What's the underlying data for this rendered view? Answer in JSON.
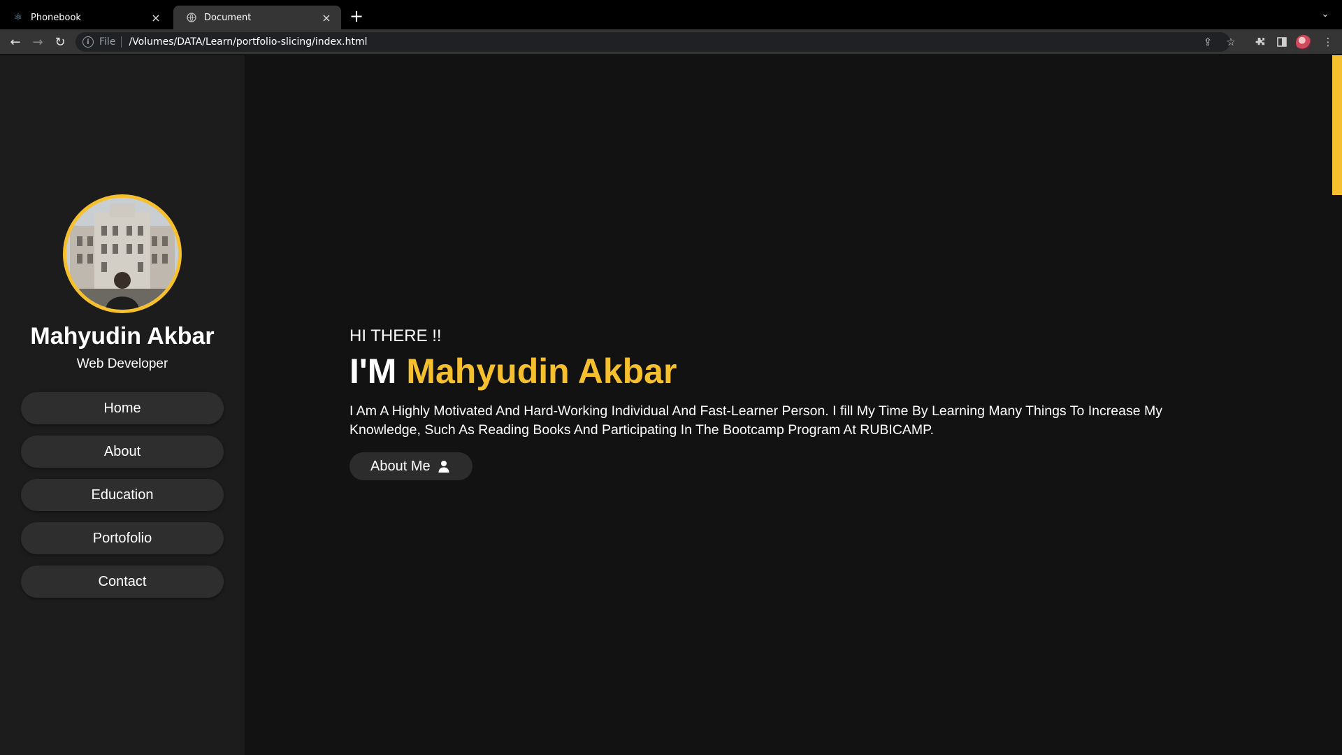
{
  "browser": {
    "tabs": [
      {
        "title": "Phonebook",
        "icon": "react-icon"
      },
      {
        "title": "Document",
        "icon": "globe-icon"
      }
    ],
    "address": {
      "scheme_label": "File",
      "url": "/Volumes/DATA/Learn/portfolio-slicing/index.html"
    }
  },
  "sidebar": {
    "name": "Mahyudin Akbar",
    "role": "Web Developer",
    "nav": [
      "Home",
      "About",
      "Education",
      "Portofolio",
      "Contact"
    ]
  },
  "hero": {
    "greeting": "HI THERE !!",
    "intro": "I'M",
    "highlight_name": "Mahyudin Akbar",
    "description": "I Am A Highly Motivated And Hard-Working Individual And Fast-Learner Person. I fill My Time By Learning Many Things To Increase My Knowledge, Such As Reading Books And Participating In The Bootcamp Program At RUBICAMP.",
    "button_label": "About Me"
  },
  "colors": {
    "accent": "#f6bf2e",
    "background": "#121212",
    "sidebar": "#1c1c1c"
  }
}
